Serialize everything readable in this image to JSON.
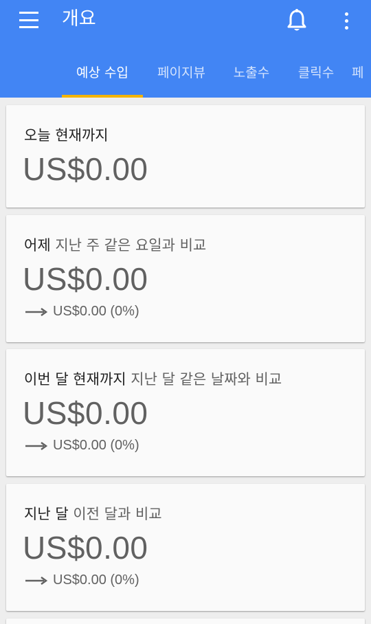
{
  "app_bar": {
    "title": "개요",
    "menu_icon": "hamburger-menu-icon",
    "notification_icon": "bell-icon",
    "more_icon": "more-vert-icon",
    "color": "#4285f4"
  },
  "tabs": [
    {
      "label": "예상 수입",
      "active": true
    },
    {
      "label": "페이지뷰",
      "active": false
    },
    {
      "label": "노출수",
      "active": false
    },
    {
      "label": "클릭수",
      "active": false
    },
    {
      "label": "페",
      "active": false
    }
  ],
  "tab_indicator_color": "#f4b400",
  "cards": [
    {
      "title": "오늘 현재까지",
      "subtitle": "",
      "value": "US$0.00",
      "compare": ""
    },
    {
      "title": "어제",
      "subtitle": "지난 주 같은 요일과 비교",
      "value": "US$0.00",
      "compare": "US$0.00 (0%)"
    },
    {
      "title": "이번 달 현재까지",
      "subtitle": "지난 달 같은 날짜와 비교",
      "value": "US$0.00",
      "compare": "US$0.00 (0%)"
    },
    {
      "title": "지난 달",
      "subtitle": "이전 달과 비교",
      "value": "US$0.00",
      "compare": "US$0.00 (0%)"
    }
  ]
}
